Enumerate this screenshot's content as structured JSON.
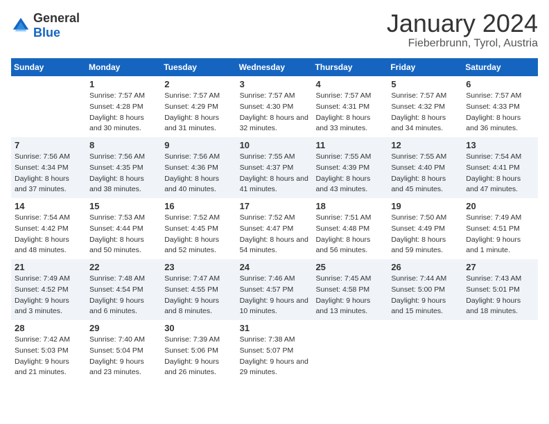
{
  "header": {
    "logo_general": "General",
    "logo_blue": "Blue",
    "title": "January 2024",
    "subtitle": "Fieberbrunn, Tyrol, Austria"
  },
  "days_of_week": [
    "Sunday",
    "Monday",
    "Tuesday",
    "Wednesday",
    "Thursday",
    "Friday",
    "Saturday"
  ],
  "weeks": [
    [
      {
        "day": "",
        "sunrise": "",
        "sunset": "",
        "daylight": ""
      },
      {
        "day": "1",
        "sunrise": "Sunrise: 7:57 AM",
        "sunset": "Sunset: 4:28 PM",
        "daylight": "Daylight: 8 hours and 30 minutes."
      },
      {
        "day": "2",
        "sunrise": "Sunrise: 7:57 AM",
        "sunset": "Sunset: 4:29 PM",
        "daylight": "Daylight: 8 hours and 31 minutes."
      },
      {
        "day": "3",
        "sunrise": "Sunrise: 7:57 AM",
        "sunset": "Sunset: 4:30 PM",
        "daylight": "Daylight: 8 hours and 32 minutes."
      },
      {
        "day": "4",
        "sunrise": "Sunrise: 7:57 AM",
        "sunset": "Sunset: 4:31 PM",
        "daylight": "Daylight: 8 hours and 33 minutes."
      },
      {
        "day": "5",
        "sunrise": "Sunrise: 7:57 AM",
        "sunset": "Sunset: 4:32 PM",
        "daylight": "Daylight: 8 hours and 34 minutes."
      },
      {
        "day": "6",
        "sunrise": "Sunrise: 7:57 AM",
        "sunset": "Sunset: 4:33 PM",
        "daylight": "Daylight: 8 hours and 36 minutes."
      }
    ],
    [
      {
        "day": "7",
        "sunrise": "Sunrise: 7:56 AM",
        "sunset": "Sunset: 4:34 PM",
        "daylight": "Daylight: 8 hours and 37 minutes."
      },
      {
        "day": "8",
        "sunrise": "Sunrise: 7:56 AM",
        "sunset": "Sunset: 4:35 PM",
        "daylight": "Daylight: 8 hours and 38 minutes."
      },
      {
        "day": "9",
        "sunrise": "Sunrise: 7:56 AM",
        "sunset": "Sunset: 4:36 PM",
        "daylight": "Daylight: 8 hours and 40 minutes."
      },
      {
        "day": "10",
        "sunrise": "Sunrise: 7:55 AM",
        "sunset": "Sunset: 4:37 PM",
        "daylight": "Daylight: 8 hours and 41 minutes."
      },
      {
        "day": "11",
        "sunrise": "Sunrise: 7:55 AM",
        "sunset": "Sunset: 4:39 PM",
        "daylight": "Daylight: 8 hours and 43 minutes."
      },
      {
        "day": "12",
        "sunrise": "Sunrise: 7:55 AM",
        "sunset": "Sunset: 4:40 PM",
        "daylight": "Daylight: 8 hours and 45 minutes."
      },
      {
        "day": "13",
        "sunrise": "Sunrise: 7:54 AM",
        "sunset": "Sunset: 4:41 PM",
        "daylight": "Daylight: 8 hours and 47 minutes."
      }
    ],
    [
      {
        "day": "14",
        "sunrise": "Sunrise: 7:54 AM",
        "sunset": "Sunset: 4:42 PM",
        "daylight": "Daylight: 8 hours and 48 minutes."
      },
      {
        "day": "15",
        "sunrise": "Sunrise: 7:53 AM",
        "sunset": "Sunset: 4:44 PM",
        "daylight": "Daylight: 8 hours and 50 minutes."
      },
      {
        "day": "16",
        "sunrise": "Sunrise: 7:52 AM",
        "sunset": "Sunset: 4:45 PM",
        "daylight": "Daylight: 8 hours and 52 minutes."
      },
      {
        "day": "17",
        "sunrise": "Sunrise: 7:52 AM",
        "sunset": "Sunset: 4:47 PM",
        "daylight": "Daylight: 8 hours and 54 minutes."
      },
      {
        "day": "18",
        "sunrise": "Sunrise: 7:51 AM",
        "sunset": "Sunset: 4:48 PM",
        "daylight": "Daylight: 8 hours and 56 minutes."
      },
      {
        "day": "19",
        "sunrise": "Sunrise: 7:50 AM",
        "sunset": "Sunset: 4:49 PM",
        "daylight": "Daylight: 8 hours and 59 minutes."
      },
      {
        "day": "20",
        "sunrise": "Sunrise: 7:49 AM",
        "sunset": "Sunset: 4:51 PM",
        "daylight": "Daylight: 9 hours and 1 minute."
      }
    ],
    [
      {
        "day": "21",
        "sunrise": "Sunrise: 7:49 AM",
        "sunset": "Sunset: 4:52 PM",
        "daylight": "Daylight: 9 hours and 3 minutes."
      },
      {
        "day": "22",
        "sunrise": "Sunrise: 7:48 AM",
        "sunset": "Sunset: 4:54 PM",
        "daylight": "Daylight: 9 hours and 6 minutes."
      },
      {
        "day": "23",
        "sunrise": "Sunrise: 7:47 AM",
        "sunset": "Sunset: 4:55 PM",
        "daylight": "Daylight: 9 hours and 8 minutes."
      },
      {
        "day": "24",
        "sunrise": "Sunrise: 7:46 AM",
        "sunset": "Sunset: 4:57 PM",
        "daylight": "Daylight: 9 hours and 10 minutes."
      },
      {
        "day": "25",
        "sunrise": "Sunrise: 7:45 AM",
        "sunset": "Sunset: 4:58 PM",
        "daylight": "Daylight: 9 hours and 13 minutes."
      },
      {
        "day": "26",
        "sunrise": "Sunrise: 7:44 AM",
        "sunset": "Sunset: 5:00 PM",
        "daylight": "Daylight: 9 hours and 15 minutes."
      },
      {
        "day": "27",
        "sunrise": "Sunrise: 7:43 AM",
        "sunset": "Sunset: 5:01 PM",
        "daylight": "Daylight: 9 hours and 18 minutes."
      }
    ],
    [
      {
        "day": "28",
        "sunrise": "Sunrise: 7:42 AM",
        "sunset": "Sunset: 5:03 PM",
        "daylight": "Daylight: 9 hours and 21 minutes."
      },
      {
        "day": "29",
        "sunrise": "Sunrise: 7:40 AM",
        "sunset": "Sunset: 5:04 PM",
        "daylight": "Daylight: 9 hours and 23 minutes."
      },
      {
        "day": "30",
        "sunrise": "Sunrise: 7:39 AM",
        "sunset": "Sunset: 5:06 PM",
        "daylight": "Daylight: 9 hours and 26 minutes."
      },
      {
        "day": "31",
        "sunrise": "Sunrise: 7:38 AM",
        "sunset": "Sunset: 5:07 PM",
        "daylight": "Daylight: 9 hours and 29 minutes."
      },
      {
        "day": "",
        "sunrise": "",
        "sunset": "",
        "daylight": ""
      },
      {
        "day": "",
        "sunrise": "",
        "sunset": "",
        "daylight": ""
      },
      {
        "day": "",
        "sunrise": "",
        "sunset": "",
        "daylight": ""
      }
    ]
  ]
}
